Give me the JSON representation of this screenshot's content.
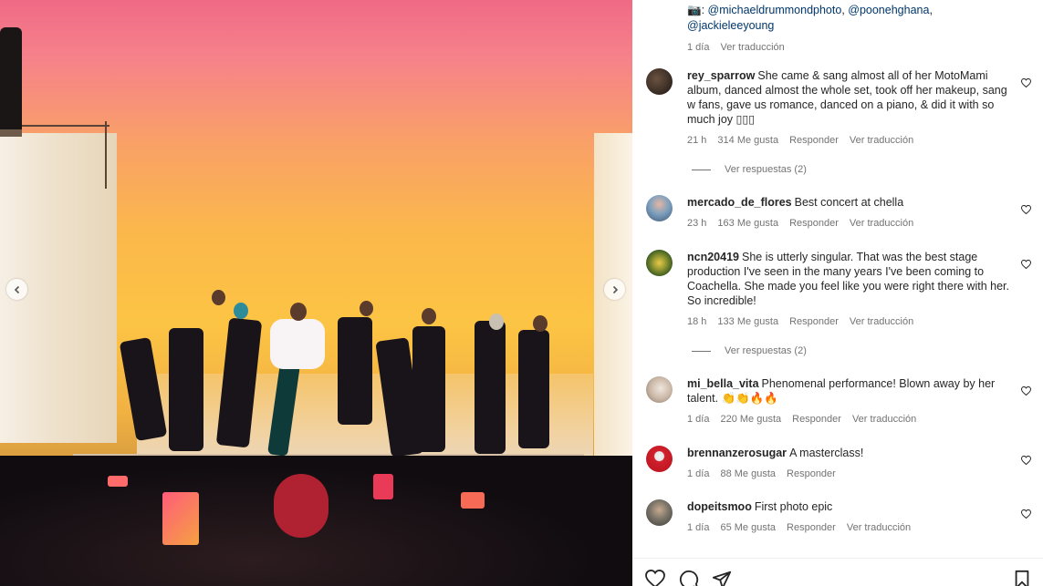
{
  "caption": {
    "prefix": "📷: ",
    "mention_1": "@michaeldrummondphoto",
    "separator": ", ",
    "mention_2": "@poonehghana",
    "mention_3": "@jackieleeyoung",
    "time": "1 día",
    "translate": "Ver traducción"
  },
  "comments": [
    {
      "user": "rey_sparrow",
      "text": "She came & sang almost all of her MotoMami album, danced almost the whole set, took off her makeup, sang w fans, gave us romance, danced on a piano, & did it with so much joy ▯▯▯",
      "time": "21 h",
      "likes": "314 Me gusta",
      "reply": "Responder",
      "translate": "Ver traducción",
      "view_replies": "Ver respuestas (2)"
    },
    {
      "user": "mercado_de_flores",
      "text": "Best concert at chella",
      "time": "23 h",
      "likes": "163 Me gusta",
      "reply": "Responder",
      "translate": "Ver traducción"
    },
    {
      "user": "ncn20419",
      "text": "She is utterly singular. That was the best stage production I've seen in the many years I've been coming to Coachella. She made you feel like you were right there with her. So incredible!",
      "time": "18 h",
      "likes": "133 Me gusta",
      "reply": "Responder",
      "translate": "Ver traducción",
      "view_replies": "Ver respuestas (2)"
    },
    {
      "user": "mi_bella_vita",
      "text": "Phenomenal performance! Blown away by her talent. 👏👏🔥🔥",
      "time": "1 día",
      "likes": "220 Me gusta",
      "reply": "Responder",
      "translate": "Ver traducción"
    },
    {
      "user": "brennanzerosugar",
      "text": "A masterclass!",
      "time": "1 día",
      "likes": "88 Me gusta",
      "reply": "Responder"
    },
    {
      "user": "dopeitsmoo",
      "text": "First photo epic",
      "time": "1 día",
      "likes": "65 Me gusta",
      "reply": "Responder",
      "translate": "Ver traducción"
    }
  ],
  "colors": {
    "text": "#262626",
    "secondary": "#737373",
    "mention": "#00376b",
    "avatar_1": "#2a211c",
    "avatar_2": "#4f6f8f",
    "avatar_3": "#4d6b2a",
    "avatar_4": "#cfc2b8",
    "avatar_5": "#c8202c",
    "avatar_6": "#5a5a52"
  },
  "icons": {
    "like": "heart-icon",
    "comment": "comment-icon",
    "share": "share-icon",
    "save": "bookmark-icon",
    "prev": "chevron-left-icon",
    "next": "chevron-right-icon"
  }
}
